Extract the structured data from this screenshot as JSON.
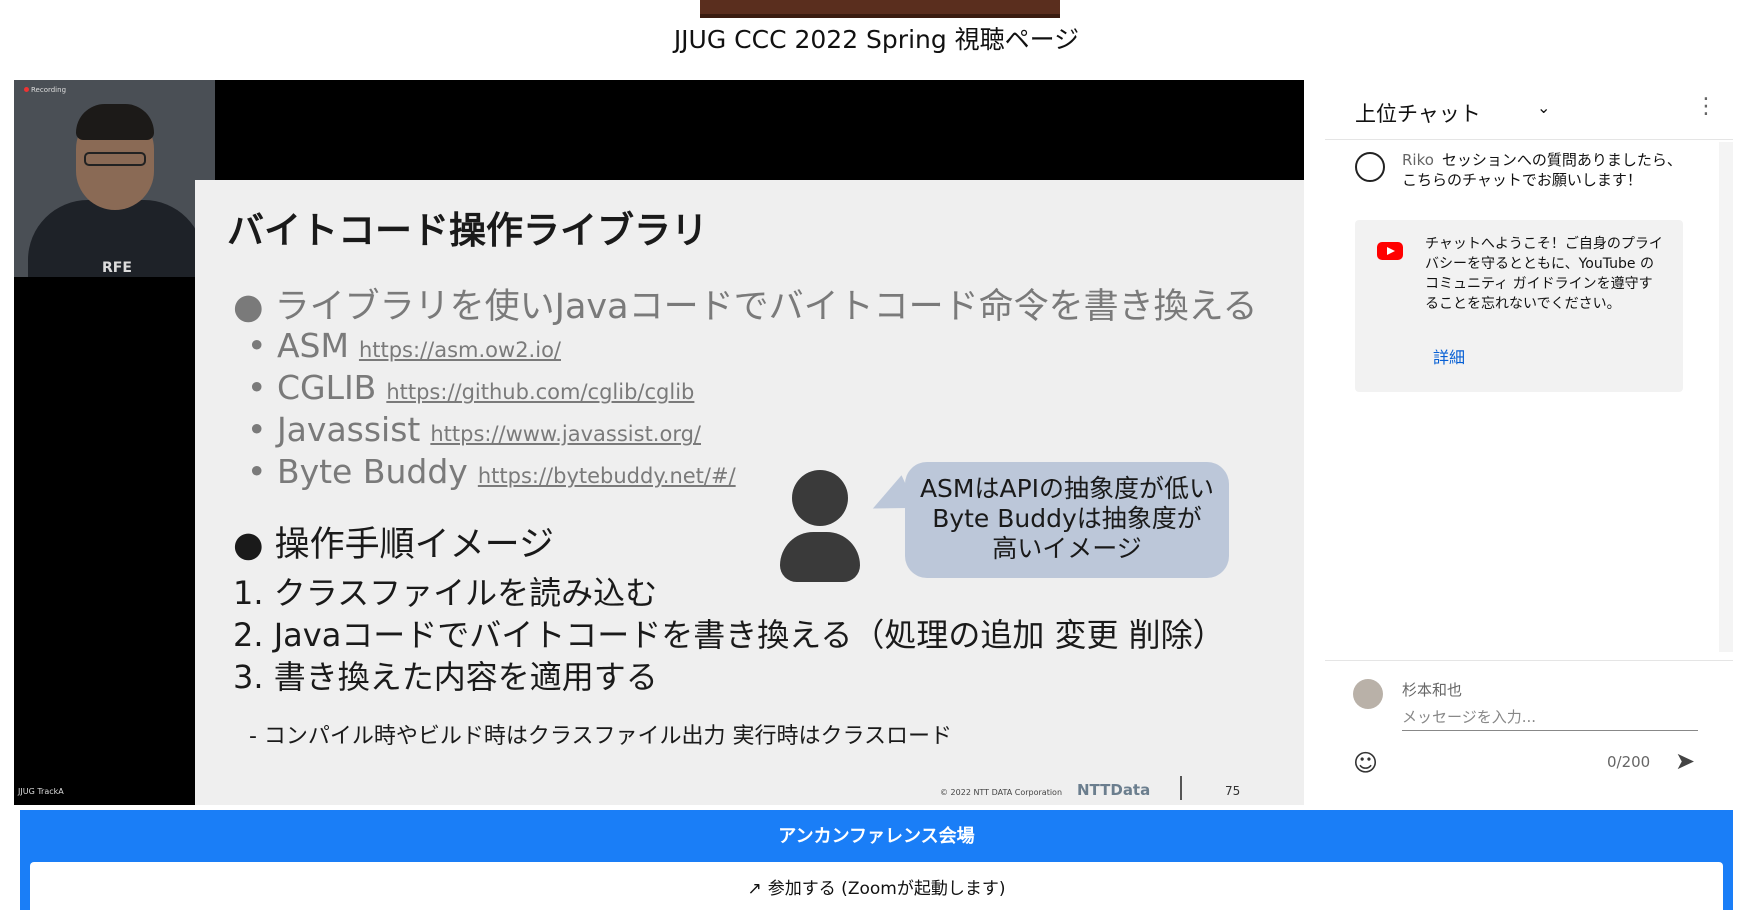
{
  "page": {
    "title": "JJUG CCC 2022 Spring 視聴ページ"
  },
  "video": {
    "recording_label": "Recording",
    "track_label": "JJUG TrackA",
    "shirt_text": "RFE",
    "slide": {
      "heading": "バイトコード操作ライブラリ",
      "bullet1": "● ライブラリを使いJavaコードでバイトコード命令を書き換える",
      "libraries": [
        {
          "name": "• ASM",
          "url": "https://asm.ow2.io/"
        },
        {
          "name": "• CGLIB",
          "url": "https://github.com/cglib/cglib"
        },
        {
          "name": "• Javassist",
          "url": "https://www.javassist.org/"
        },
        {
          "name": "• Byte Buddy",
          "url": "https://bytebuddy.net/#/"
        }
      ],
      "bubble_text": "ASMはAPIの抽象度が低い\nByte Buddyは抽象度が\n高いイメージ",
      "bullet2": "● 操作手順イメージ",
      "steps": [
        "1.  クラスファイルを読み込む",
        "2.  Javaコードでバイトコードを書き換える（処理の追加 変更 削除）",
        "3.  書き換えた内容を適用する"
      ],
      "sub_step": "-      コンパイル時やビルド時はクラスファイル出力 実行時はクラスロード",
      "footer_copyright": "© 2022 NTT DATA Corporation",
      "footer_brand": "NTTData",
      "footer_page": "75"
    }
  },
  "chat": {
    "mode_label": "上位チャット",
    "messages": [
      {
        "author": "Riko",
        "text": "セッションへの質問ありましたら、こちらのチャットでお願いします！"
      }
    ],
    "notice": {
      "text": "チャットへようこそ！ご自身のプライバシーを守るとともに、YouTube のコミュニティ ガイドラインを遵守することを忘れないでください。",
      "link": "詳細"
    },
    "composer": {
      "user_name": "杉本和也",
      "placeholder": "メッセージを入力...",
      "counter": "0/200"
    }
  },
  "unconference": {
    "title": "アンカンファレンス会場",
    "join_label": "参加する (Zoomが起動します)"
  }
}
